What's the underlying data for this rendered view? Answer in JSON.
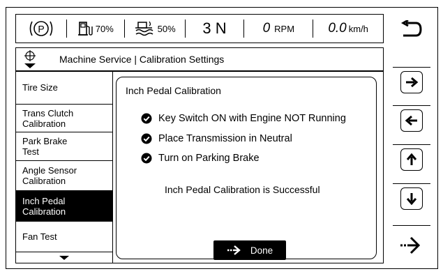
{
  "status": {
    "park_icon": "park-brake-icon",
    "fuel_pct": "70%",
    "def_pct": "50%",
    "gear": "3 N",
    "rpm_value": "0",
    "rpm_unit": "RPM",
    "speed_value": "0.0",
    "speed_unit": "km/h"
  },
  "title": "Machine Service | Calibration Settings",
  "menu": {
    "items": [
      {
        "label": "Tire Size",
        "active": false
      },
      {
        "label": "Trans Clutch\nCalibration",
        "active": false
      },
      {
        "label": "Park Brake\nTest",
        "active": false
      },
      {
        "label": "Angle Sensor\nCalibration",
        "active": false
      },
      {
        "label": "Inch Pedal\nCalibration",
        "active": true
      },
      {
        "label": "Fan Test",
        "active": false
      }
    ]
  },
  "content": {
    "title": "Inch Pedal Calibration",
    "checks": [
      "Key Switch ON with Engine NOT Running",
      "Place Transmission in Neutral",
      "Turn on Parking Brake"
    ],
    "result": "Inch Pedal Calibration is Successful",
    "done_label": "Done"
  },
  "nav": [
    "back-icon",
    "arrow-right-icon",
    "arrow-left-icon",
    "arrow-up-icon",
    "arrow-down-icon",
    "enter-icon"
  ]
}
